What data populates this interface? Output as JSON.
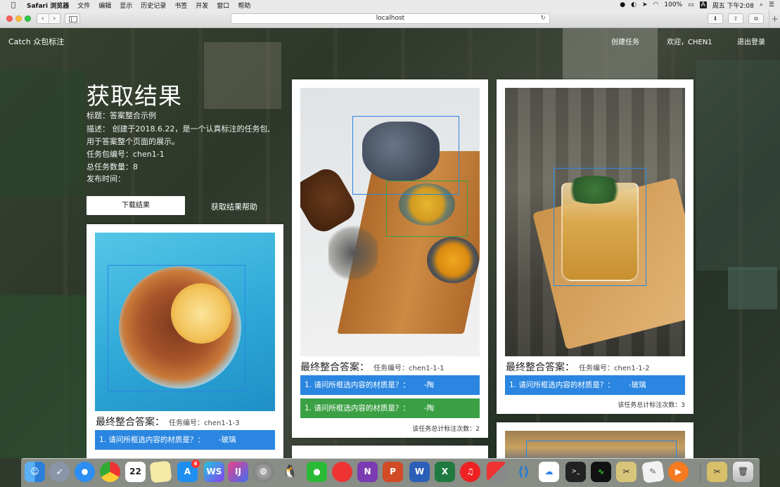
{
  "menubar": {
    "app_name": "Safari 浏览器",
    "items": [
      "文件",
      "编辑",
      "显示",
      "历史记录",
      "书签",
      "开发",
      "窗口",
      "帮助"
    ],
    "battery": "100%",
    "clock": "周五 下午2:08",
    "input_source": "A"
  },
  "browser": {
    "url": "localhost",
    "back_glyph": "‹",
    "forward_glyph": "›",
    "reload_glyph": "↻",
    "new_tab_glyph": "+"
  },
  "site": {
    "brand": "Catch 众包标注",
    "nav": {
      "create_task": "创建任务",
      "welcome": "欢迎，CHEN1",
      "logout": "退出登录"
    }
  },
  "hero": {
    "title": "获取结果",
    "label_title": "标题：答案整合示例",
    "label_desc_1": "描述： 创建于2018.6.22，是一个认真标注的任务包,",
    "label_desc_2": "用于答案整个页面的展示。",
    "label_package": "任务包编号：chen1-1",
    "label_total": "总任务数量：8",
    "label_publish": "发布时间：",
    "download_button": "下载结果",
    "help_link": "获取结果帮助"
  },
  "cards": [
    {
      "final_label": "最终整合答案：",
      "task_no": "任务编号：chen1-1-3",
      "answers": [
        {
          "q": "1. 请问所框选内容的材质是？：",
          "a": "-玻璃",
          "color": "#2a86e0"
        }
      ],
      "count": ""
    },
    {
      "final_label": "最终整合答案：",
      "task_no": "任务编号：chen1-1-1",
      "answers": [
        {
          "q": "1. 请问所框选内容的材质是？：",
          "a": "-陶",
          "color": "#2a86e0"
        },
        {
          "q": "1. 请问所框选内容的材质是？：",
          "a": "-陶",
          "color": "#3ba044"
        }
      ],
      "count": "该任务总计标注次数：2"
    },
    {
      "final_label": "最终整合答案：",
      "task_no": "任务编号：chen1-1-2",
      "answers": [
        {
          "q": "1. 请问所框选内容的材质是？：",
          "a": "-玻璃",
          "color": "#2a86e0"
        }
      ],
      "count": "该任务总计标注次数：3"
    }
  ],
  "dock": {
    "icons": [
      "finder-icon",
      "launchpad-icon",
      "safari-icon",
      "chrome-icon",
      "calendar-icon",
      "notes-icon",
      "app-store-icon",
      "webstorm-icon",
      "intellij-icon",
      "system-preferences-icon",
      "qq-icon",
      "wechat-icon",
      "paw-icon",
      "onenote-icon",
      "powerpoint-icon",
      "word-icon",
      "excel-icon",
      "netease-music-icon",
      "parallels-icon",
      "vscode-icon",
      "baidu-netdisk-icon",
      "terminal-icon",
      "activity-monitor-icon",
      "screenshot-icon",
      "textedit-icon",
      "infuse-icon",
      "archive-icon",
      "trash-icon"
    ],
    "calendar_day": "22",
    "app_store_badge": "6",
    "ws_label": "WS",
    "ij_label": "IJ",
    "n_label": "N",
    "p_label": "P",
    "w_label": "W",
    "x_label": "X"
  }
}
